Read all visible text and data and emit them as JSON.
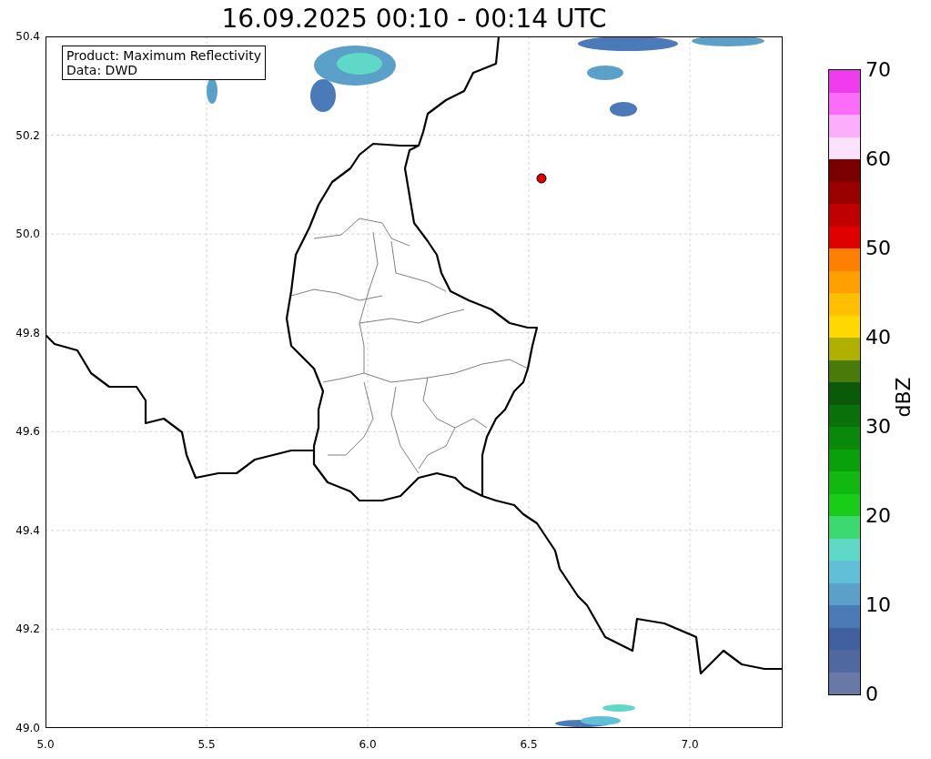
{
  "title": "16.09.2025 00:10 - 00:14 UTC",
  "map": {
    "x_ticks": [
      "5.0",
      "5.5",
      "6.0",
      "6.5",
      "7.0"
    ],
    "y_ticks": [
      "50.4",
      "50.2",
      "50.0",
      "49.8",
      "49.6",
      "49.4",
      "49.2",
      "49.0"
    ],
    "legend": [
      "Product: Maximum Reflectivity",
      "Data: DWD"
    ]
  },
  "colorbar": {
    "label": "dBZ",
    "ticks": [
      "70",
      "60",
      "50",
      "40",
      "30",
      "20",
      "10",
      "0"
    ],
    "bins": [
      {
        "color": "#ef3cef"
      },
      {
        "color": "#fb6cfb"
      },
      {
        "color": "#fcaefc"
      },
      {
        "color": "#fde0fd"
      },
      {
        "color": "#7a0000"
      },
      {
        "color": "#9a0000"
      },
      {
        "color": "#c00000"
      },
      {
        "color": "#e00000"
      },
      {
        "color": "#ff8000"
      },
      {
        "color": "#ffa000"
      },
      {
        "color": "#ffbe00"
      },
      {
        "color": "#ffd800"
      },
      {
        "color": "#b0b000"
      },
      {
        "color": "#4a7a0a"
      },
      {
        "color": "#0a5a0a"
      },
      {
        "color": "#0a700a"
      },
      {
        "color": "#0a880a"
      },
      {
        "color": "#0aa00a"
      },
      {
        "color": "#10b810"
      },
      {
        "color": "#18cc18"
      },
      {
        "color": "#3cd870"
      },
      {
        "color": "#60d8c8"
      },
      {
        "color": "#60c0d8"
      },
      {
        "color": "#5aa0c8"
      },
      {
        "color": "#4a7ab8"
      },
      {
        "color": "#4060a0"
      },
      {
        "color": "#5068a0"
      },
      {
        "color": "#6a78a8"
      }
    ]
  }
}
